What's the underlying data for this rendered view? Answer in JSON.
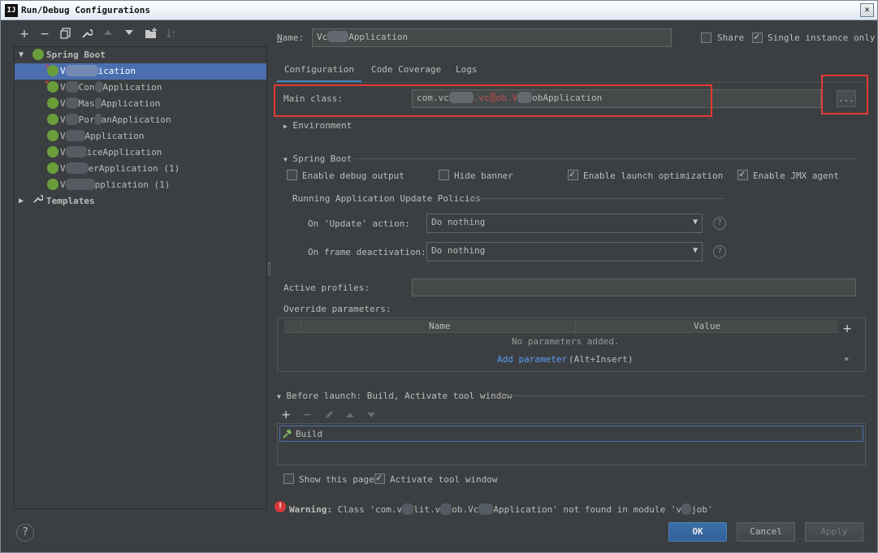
{
  "window": {
    "title": "Run/Debug Configurations",
    "app_icon": "IJ",
    "close_label": "✕"
  },
  "toolbar": {
    "icons": [
      "plus-icon",
      "minus-icon",
      "copy-icon",
      "wrench-icon",
      "arrow-up-icon",
      "arrow-down-icon",
      "folder-add-icon",
      "sort-icon"
    ],
    "add": "+",
    "remove": "−"
  },
  "tree": {
    "spring_boot_label": "Spring Boot",
    "templates_label": "Templates",
    "items": [
      {
        "label": "V",
        "suffix": "ication",
        "error": true,
        "selected": true
      },
      {
        "label": "V",
        "suffix": "Con",
        "suffix2": "Application",
        "error": true
      },
      {
        "label": "V",
        "suffix": "Mas",
        "suffix2": "Application"
      },
      {
        "label": "V",
        "suffix": "Por",
        "suffix2": "anApplication"
      },
      {
        "label": "V",
        "suffix": "Application"
      },
      {
        "label": "V",
        "suffix": "iceApplication"
      },
      {
        "label": "V",
        "suffix": "erApplication (1)"
      },
      {
        "label": "V",
        "suffix": "pplication (1)"
      }
    ]
  },
  "form": {
    "name_label": "Name:",
    "name_value_a": "Vc",
    "name_value_b": "Application",
    "share_label": "Share",
    "single_instance_label": "Single instance only",
    "tabs": [
      "Configuration",
      "Code Coverage",
      "Logs"
    ],
    "main_class_label": "Main class:",
    "main_class_a": "com.vc",
    "main_class_b": ".vc",
    "main_class_c": "ob.V",
    "main_class_d": "obApplication",
    "browse_button": "...",
    "environment_label": "Environment",
    "spring_boot_section": "Spring Boot",
    "enable_debug_output": "Enable debug output",
    "hide_banner": "Hide banner",
    "enable_launch_optimization": "Enable launch optimization",
    "enable_jmx_agent": "Enable JMX agent",
    "policies_label": "Running Application Update Policies",
    "on_update_label": "On 'Update' action:",
    "on_update_value": "Do nothing",
    "on_frame_label": "On frame deactivation:",
    "on_frame_value": "Do nothing",
    "active_profiles_label": "Active profiles:",
    "override_parameters_label": "Override parameters:",
    "params_table": {
      "col_name": "Name",
      "col_value": "Value",
      "empty_text": "No parameters added.",
      "add_link": "Add parameter",
      "add_shortcut": "(Alt+Insert)"
    },
    "before_launch_label": "Before launch: Build, Activate tool window",
    "before_launch_item": "Build",
    "show_this_page": "Show this page",
    "activate_tool_window": "Activate tool window",
    "warning_label": "Warning:",
    "warning_text": "Class 'com.v",
    "warning_text2": "lit.v",
    "warning_text3": "ob.Vc",
    "warning_text4": "Application' not found in module 'v",
    "warning_text5": "job'"
  },
  "buttons": {
    "ok": "OK",
    "cancel": "Cancel",
    "apply": "Apply",
    "help": "?"
  },
  "colors": {
    "background": "#3c3f41",
    "selection": "#4b6eaf",
    "highlight_box": "#e53935",
    "link": "#589df6",
    "spring_leaf": "#6a9e3b"
  }
}
